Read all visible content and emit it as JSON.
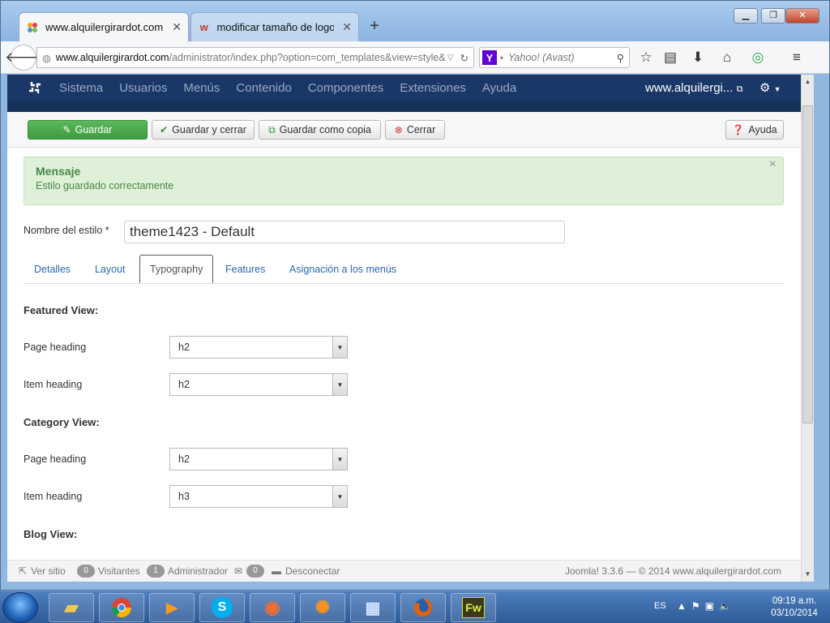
{
  "browser": {
    "tabs": [
      {
        "title": "www.alquilergirardot.com ...",
        "active": true
      },
      {
        "title": "modificar tamaño de logo ...",
        "active": false
      }
    ],
    "url": {
      "domain": "www.alquilergirardot.com",
      "path": "/administrator/index.php?option=com_templates&view=style&"
    },
    "search_placeholder": "Yahoo! (Avast)"
  },
  "joomla_nav": {
    "menu": [
      "Sistema",
      "Usuarios",
      "Menús",
      "Contenido",
      "Componentes",
      "Extensiones",
      "Ayuda"
    ],
    "site_link": "www.alquilergi..."
  },
  "toolbar": {
    "save": "Guardar",
    "save_close": "Guardar y cerrar",
    "save_copy": "Guardar como copia",
    "close": "Cerrar",
    "help": "Ayuda"
  },
  "message": {
    "heading": "Mensaje",
    "text": "Estilo guardado correctamente"
  },
  "form": {
    "name_label": "Nombre del estilo *",
    "name_value": "theme1423 - Default"
  },
  "tabs": [
    "Detalles",
    "Layout",
    "Typography",
    "Features",
    "Asignación a los menús"
  ],
  "selected_tab": "Typography",
  "sections": {
    "featured": {
      "title": "Featured View:",
      "page_heading_label": "Page heading",
      "page_heading_value": "h2",
      "item_heading_label": "Item heading",
      "item_heading_value": "h2"
    },
    "category": {
      "title": "Category View:",
      "page_heading_label": "Page heading",
      "page_heading_value": "h2",
      "item_heading_label": "Item heading",
      "item_heading_value": "h3"
    },
    "blog": {
      "title": "Blog View:"
    }
  },
  "statusbar": {
    "view_site": "Ver sitio",
    "visitors_count": "0",
    "visitors_label": "Visitantes",
    "admin_count": "1",
    "admin_label": "Administrador",
    "messages_count": "0",
    "logout": "Desconectar",
    "footer": "Joomla! 3.3.6  —  © 2014 www.alquilergirardot.com"
  },
  "taskbar": {
    "language": "ES",
    "time": "09:19 a.m.",
    "date": "03/10/2014",
    "fw_label": "Fw"
  },
  "colors": {
    "joomla_nav": "#1a3867",
    "save_green": "#4cae4c",
    "alert_bg": "#dff0d8",
    "alert_text": "#468847",
    "link_blue": "#2a69b0"
  }
}
